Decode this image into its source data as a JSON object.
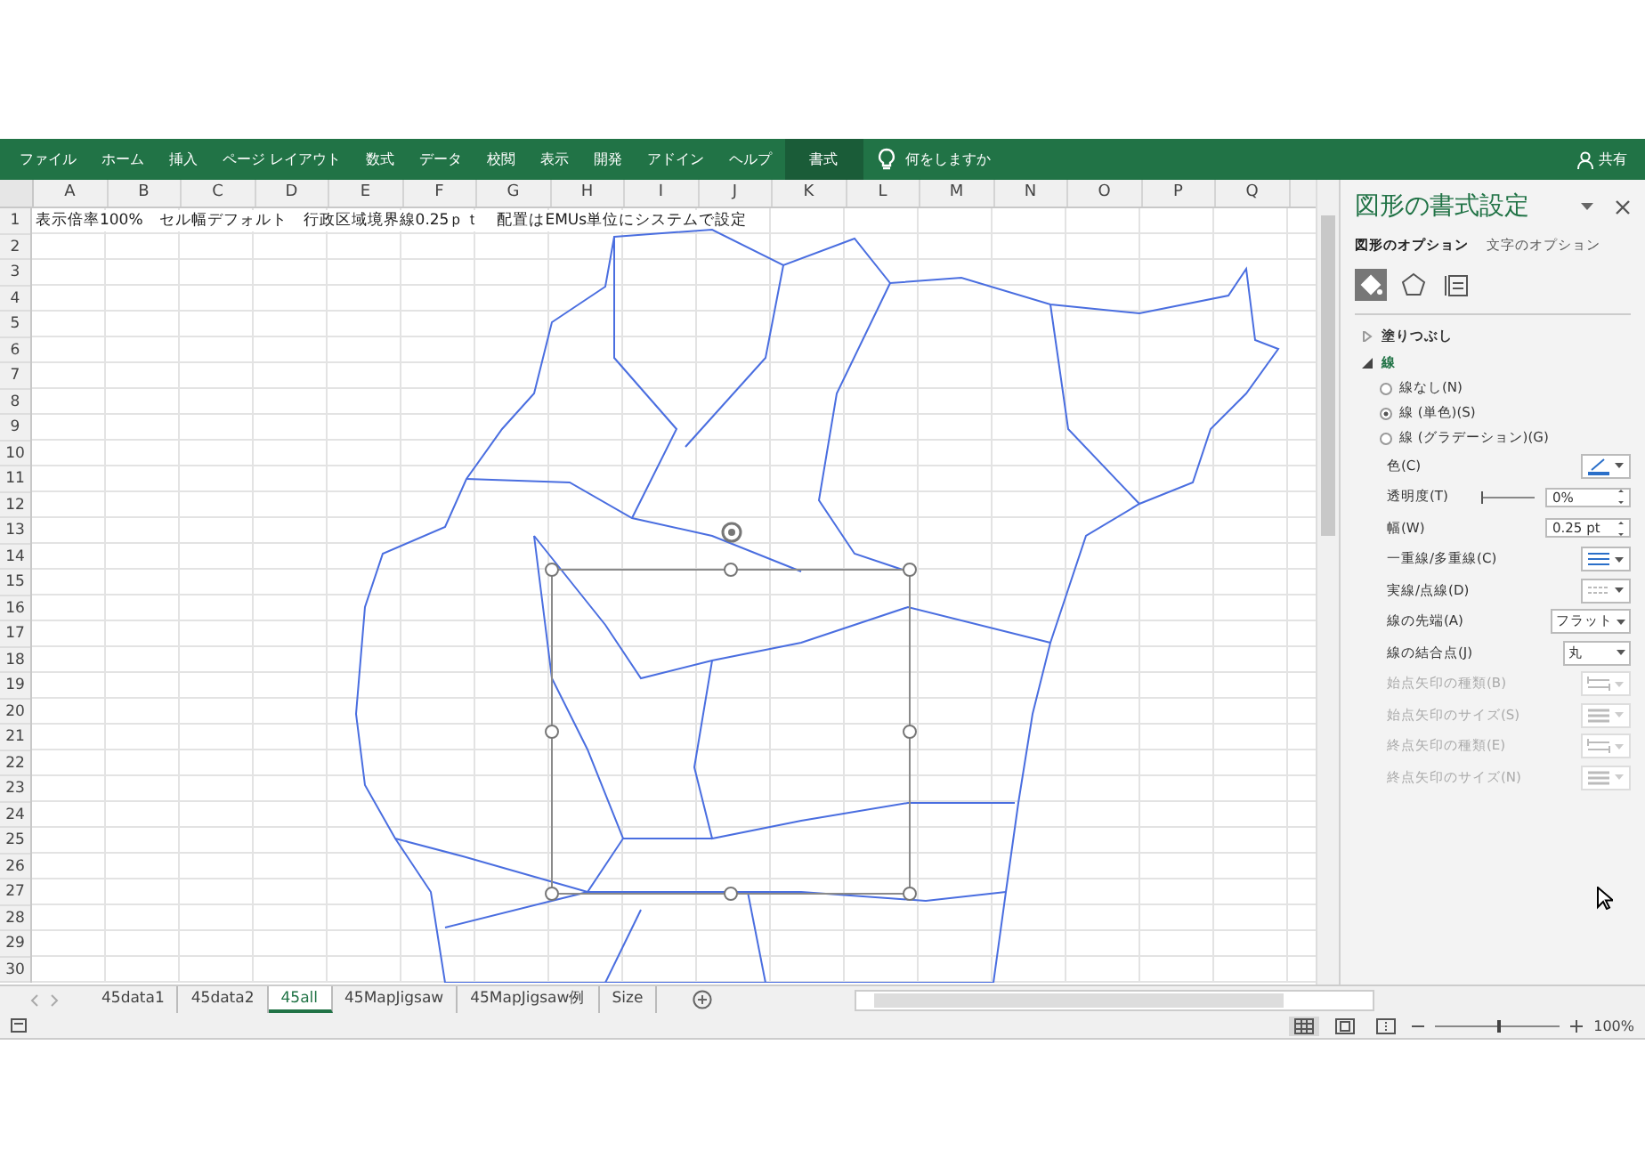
{
  "ribbon": {
    "tabs": [
      {
        "label": "ファイル",
        "selected": false
      },
      {
        "label": "ホーム",
        "selected": false
      },
      {
        "label": "挿入",
        "selected": false
      },
      {
        "label": "ページ レイアウト",
        "selected": false
      },
      {
        "label": "数式",
        "selected": false
      },
      {
        "label": "データ",
        "selected": false
      },
      {
        "label": "校閲",
        "selected": false
      },
      {
        "label": "表示",
        "selected": false
      },
      {
        "label": "開発",
        "selected": false
      },
      {
        "label": "アドイン",
        "selected": false
      },
      {
        "label": "ヘルプ",
        "selected": false
      },
      {
        "label": "書式",
        "selected": true
      }
    ],
    "tell_me": "何をしますか",
    "share": "共有"
  },
  "sheet": {
    "columns": [
      "A",
      "B",
      "C",
      "D",
      "E",
      "F",
      "G",
      "H",
      "I",
      "J",
      "K",
      "L",
      "M",
      "N",
      "O",
      "P",
      "Q"
    ],
    "rows": [
      "1",
      "2",
      "3",
      "4",
      "5",
      "6",
      "7",
      "8",
      "9",
      "10",
      "11",
      "12",
      "13",
      "14",
      "15",
      "16",
      "17",
      "18",
      "19",
      "20",
      "21",
      "22",
      "23",
      "24",
      "25",
      "26",
      "27",
      "28",
      "29",
      "30"
    ],
    "cell_a1": "表示倍率100%　セル幅デフォルト　行政区域境界線0.25ｐｔ　配置はEMUs単位にシステムで設定"
  },
  "sheet_tabs": [
    {
      "label": "45data1",
      "selected": false
    },
    {
      "label": "45data2",
      "selected": false
    },
    {
      "label": "45all",
      "selected": true
    },
    {
      "label": "45MapJigsaw",
      "selected": false
    },
    {
      "label": "45MapJigsaw例",
      "selected": false
    },
    {
      "label": "Size",
      "selected": false
    }
  ],
  "panel": {
    "title": "図形の書式設定",
    "tabs": [
      {
        "label": "図形のオプション",
        "selected": true
      },
      {
        "label": "文字のオプション",
        "selected": false
      }
    ],
    "icon_tabs": [
      {
        "kind": "fill",
        "selected": true
      },
      {
        "kind": "shape",
        "selected": false
      },
      {
        "kind": "size",
        "selected": false
      }
    ],
    "sections": [
      {
        "label": "塗りつぶし",
        "expanded": false
      },
      {
        "label": "線",
        "expanded": true
      }
    ],
    "line_types": [
      {
        "label": "線なし(N)",
        "selected": false
      },
      {
        "label": "線 (単色)(S)",
        "selected": true
      },
      {
        "label": "線 (グラデーション)(G)",
        "selected": false
      }
    ],
    "properties": [
      {
        "label": "色(C)",
        "kind": "color",
        "disabled": false
      },
      {
        "label": "透明度(T)",
        "kind": "slider",
        "value": "0%",
        "level": 0,
        "disabled": false
      },
      {
        "label": "幅(W)",
        "kind": "spin",
        "value": "0.25 pt",
        "disabled": false
      },
      {
        "label": "一重線/多重線(C)",
        "kind": "compound",
        "disabled": false
      },
      {
        "label": "実線/点線(D)",
        "kind": "dash",
        "disabled": false
      },
      {
        "label": "線の先端(A)",
        "kind": "text",
        "value": "フラット",
        "disabled": false
      },
      {
        "label": "線の結合点(J)",
        "kind": "text",
        "value": "丸",
        "disabled": false
      },
      {
        "label": "始点矢印の種類(B)",
        "kind": "arrow",
        "disabled": true
      },
      {
        "label": "始点矢印のサイズ(S)",
        "kind": "size",
        "disabled": true
      },
      {
        "label": "終点矢印の種類(E)",
        "kind": "arrow",
        "disabled": true
      },
      {
        "label": "終点矢印のサイズ(N)",
        "kind": "size",
        "disabled": true
      }
    ]
  },
  "status_bar": {
    "views": [
      {
        "kind": "normal",
        "selected": true
      },
      {
        "kind": "layout",
        "selected": false
      },
      {
        "kind": "pagebreak",
        "selected": false
      }
    ],
    "zoom": {
      "level": 0.5,
      "reading": "100%"
    }
  }
}
